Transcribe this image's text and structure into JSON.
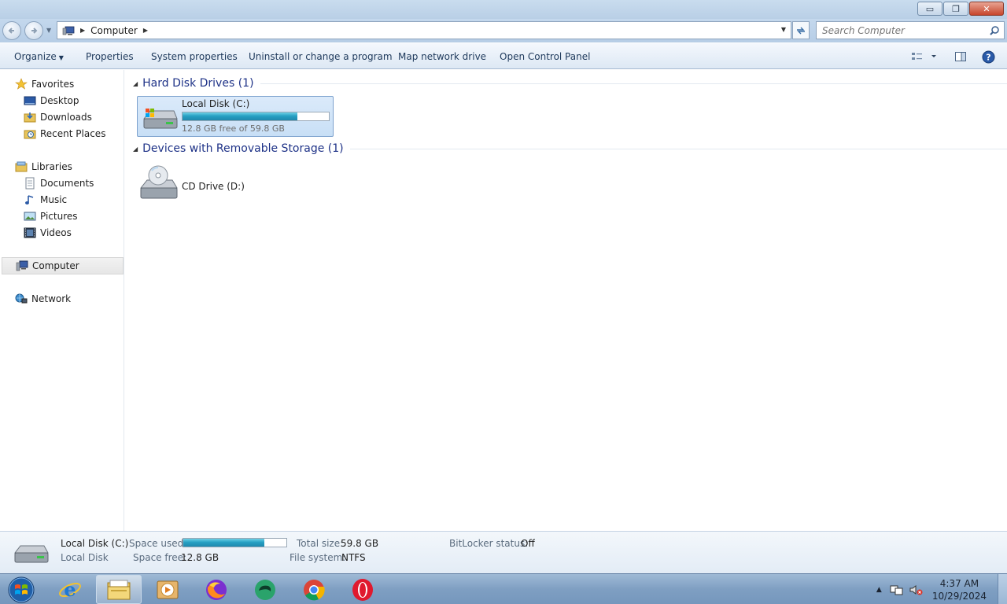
{
  "window": {
    "minimize": "▭",
    "maximize": "❐",
    "close": "✕"
  },
  "address": {
    "crumb": "Computer",
    "search_placeholder": "Search Computer"
  },
  "toolbar": {
    "organize": "Organize",
    "properties": "Properties",
    "system_properties": "System properties",
    "uninstall": "Uninstall or change a program",
    "map_drive": "Map network drive",
    "control_panel": "Open Control Panel"
  },
  "nav": {
    "favorites": "Favorites",
    "desktop": "Desktop",
    "downloads": "Downloads",
    "recent": "Recent Places",
    "libraries": "Libraries",
    "documents": "Documents",
    "music": "Music",
    "pictures": "Pictures",
    "videos": "Videos",
    "computer": "Computer",
    "network": "Network"
  },
  "groups": {
    "hdd": {
      "title": "Hard Disk Drives (1)"
    },
    "removable": {
      "title": "Devices with Removable Storage (1)"
    }
  },
  "drives": {
    "c": {
      "name": "Local Disk (C:)",
      "free_text": "12.8 GB free of 59.8 GB",
      "used_fraction": 0.786
    },
    "d": {
      "name": "CD Drive (D:)"
    }
  },
  "details": {
    "name": "Local Disk (C:)",
    "type": "Local Disk",
    "space_used_label": "Space used:",
    "space_free_label": "Space free:",
    "space_free": "12.8 GB",
    "total_size_label": "Total size:",
    "total_size": "59.8 GB",
    "file_system_label": "File system:",
    "file_system": "NTFS",
    "bitlocker_label": "BitLocker status:",
    "bitlocker": "Off"
  },
  "taskbar": {
    "time": "4:37 AM",
    "date": "10/29/2024"
  },
  "colors": {
    "accent": "#1e3287",
    "bar_fill": "#26a0c3",
    "selection": "#cce4f7"
  }
}
